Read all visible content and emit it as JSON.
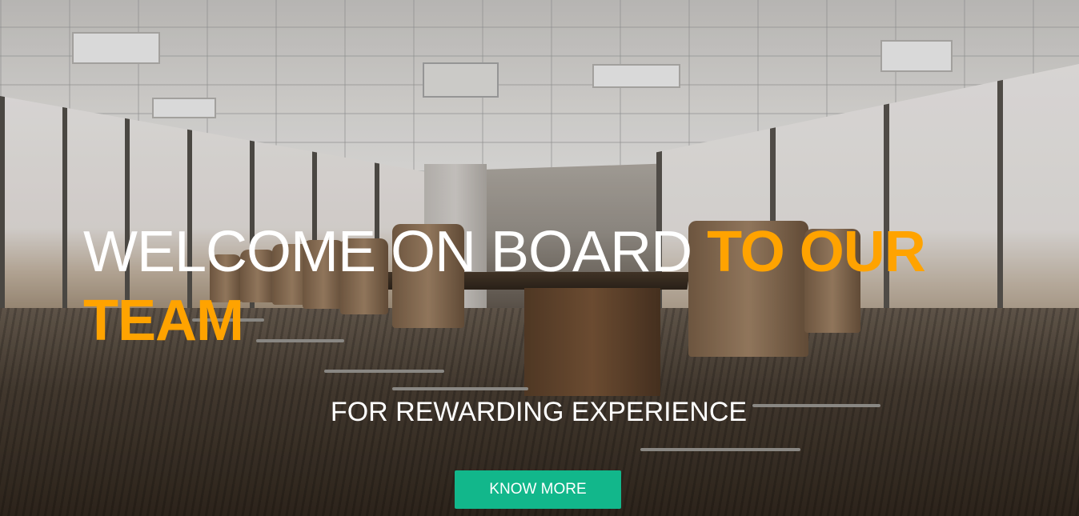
{
  "hero": {
    "headline_part1": "WELCOME ON BOARD ",
    "headline_accent": "TO OUR TEAM",
    "subheadline": "FOR REWARDING EXPERIENCE",
    "cta_label": "KNOW MORE"
  },
  "colors": {
    "accent": "#ffa300",
    "button": "#12b78b",
    "text": "#ffffff"
  }
}
